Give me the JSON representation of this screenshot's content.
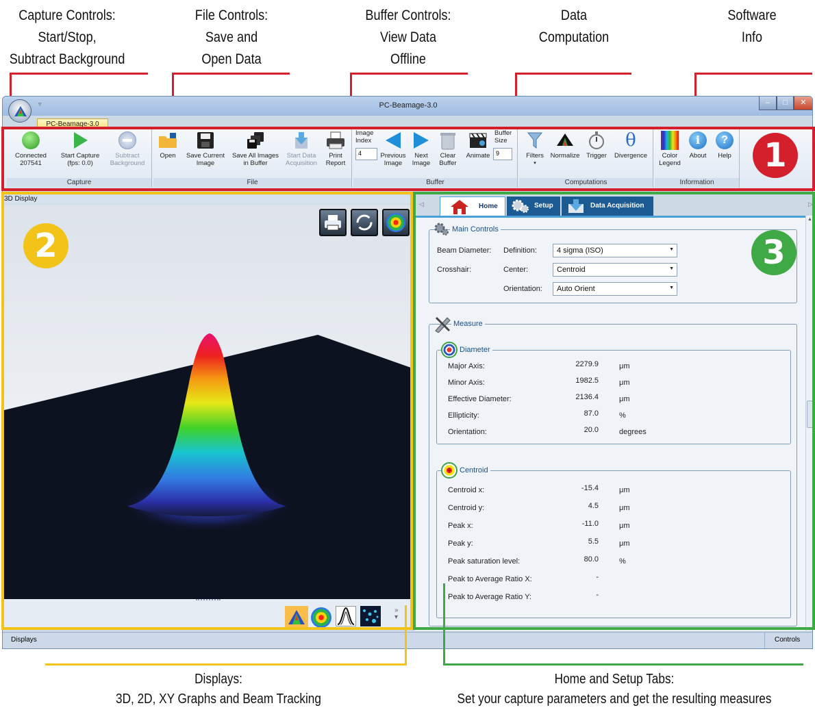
{
  "annotations": {
    "top": [
      {
        "text": "Capture Controls:\nStart/Stop,\nSubtract Background"
      },
      {
        "text": "File Controls:\nSave and\nOpen Data"
      },
      {
        "text": "Buffer Controls:\nView Data\nOffline"
      },
      {
        "text": "Data\nComputation"
      },
      {
        "text": "Software\nInfo"
      }
    ],
    "bottom_left": "Displays:\n3D, 2D, XY Graphs and Beam Tracking",
    "bottom_right": "Home and Setup Tabs:\nSet your capture parameters and get the resulting measures",
    "badges": [
      "1",
      "2",
      "3"
    ],
    "colors": {
      "red": "#d4202c",
      "yellow": "#f2c319",
      "green": "#3ea945"
    }
  },
  "window": {
    "title": "PC-Beamage-3.0",
    "app_tab": "PC-Beamage-3.0"
  },
  "ribbon": {
    "groups": [
      "Capture",
      "File",
      "Buffer",
      "Computations",
      "Information"
    ],
    "capture": {
      "connected": "Connected",
      "serial": "207541",
      "start_capture": "Start Capture",
      "fps": "(fps: 0.0)",
      "subtract": "Subtract",
      "background": "Background"
    },
    "file": {
      "open": "Open",
      "save_current_1": "Save Current",
      "save_current_2": "Image",
      "save_all_1": "Save All Images",
      "save_all_2": "in Buffer",
      "start_data_1": "Start Data",
      "start_data_2": "Acquisition",
      "print_1": "Print",
      "print_2": "Report"
    },
    "buffer": {
      "image_index_1": "Image",
      "image_index_2": "Index",
      "index_value": "4",
      "prev_1": "Previous",
      "prev_2": "Image",
      "next_1": "Next",
      "next_2": "Image",
      "clear_1": "Clear",
      "clear_2": "Buffer",
      "animate": "Animate",
      "buffer_size_1": "Buffer",
      "buffer_size_2": "Size",
      "size_value": "9"
    },
    "computations": {
      "filters": "Filters",
      "normalize": "Normalize",
      "trigger": "Trigger",
      "divergence": "Divergence"
    },
    "information": {
      "color_1": "Color",
      "color_2": "Legend",
      "about": "About",
      "help": "Help"
    }
  },
  "display": {
    "title": "3D Display",
    "status_left": "Displays",
    "status_right": "Controls"
  },
  "panel": {
    "tabs": [
      "Home",
      "Setup",
      "Data Acquisition"
    ],
    "main_controls": {
      "legend": "Main Controls",
      "beam_diameter": "Beam Diameter:",
      "definition": "Definition:",
      "definition_value": "4 sigma (ISO)",
      "crosshair": "Crosshair:",
      "center": "Center:",
      "center_value": "Centroid",
      "orientation": "Orientation:",
      "orientation_value": "Auto Orient"
    },
    "measure": {
      "legend": "Measure",
      "diameter": {
        "legend": "Diameter",
        "rows": [
          {
            "label": "Major Axis:",
            "value": "2279.9",
            "unit": "μm"
          },
          {
            "label": "Minor Axis:",
            "value": "1982.5",
            "unit": "μm"
          },
          {
            "label": "Effective Diameter:",
            "value": "2136.4",
            "unit": "μm"
          },
          {
            "label": "Ellipticity:",
            "value": "87.0",
            "unit": "%"
          },
          {
            "label": "Orientation:",
            "value": "20.0",
            "unit": "degrees"
          }
        ]
      },
      "centroid": {
        "legend": "Centroid",
        "rows": [
          {
            "label": "Centroid x:",
            "value": "-15.4",
            "unit": "μm"
          },
          {
            "label": "Centroid y:",
            "value": "4.5",
            "unit": "μm"
          },
          {
            "label": "Peak x:",
            "value": "-11.0",
            "unit": "μm"
          },
          {
            "label": "Peak y:",
            "value": "5.5",
            "unit": "μm"
          },
          {
            "label": "Peak saturation level:",
            "value": "80.0",
            "unit": "%"
          },
          {
            "label": "Peak to Average Ratio X:",
            "value": "-",
            "unit": ""
          },
          {
            "label": "Peak to Average Ratio Y:",
            "value": "-",
            "unit": ""
          }
        ]
      }
    }
  }
}
